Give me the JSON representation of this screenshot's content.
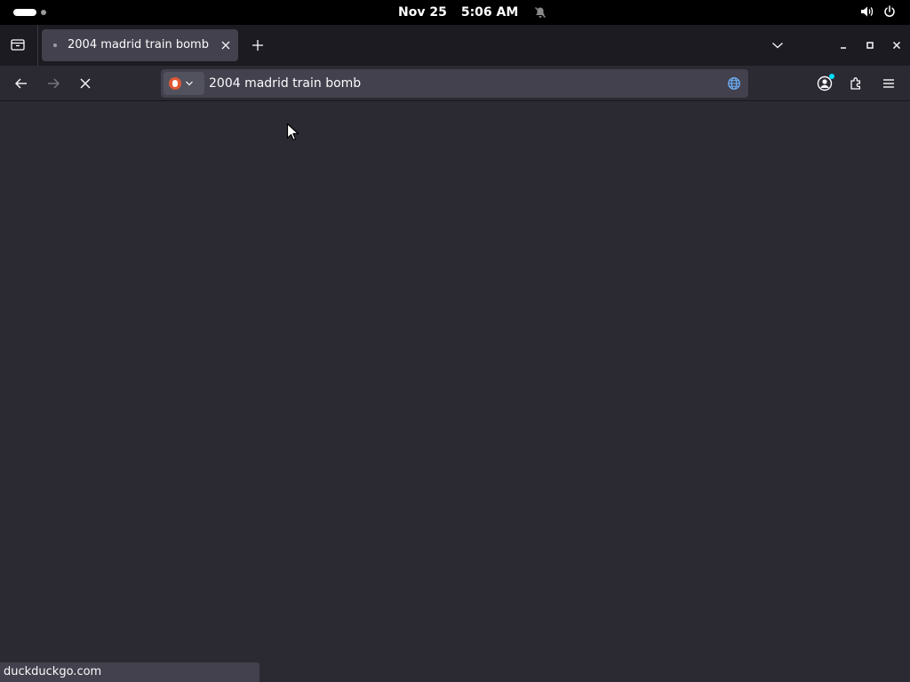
{
  "system_bar": {
    "date": "Nov 25",
    "time": "5:06 AM",
    "icons": [
      "activities-indicator",
      "notifications-off-icon",
      "volume-icon",
      "power-icon"
    ]
  },
  "browser": {
    "tabs": [
      {
        "title": "2004 madrid train bomb",
        "active": true
      }
    ],
    "address_bar": {
      "value": "2004 madrid train bomb",
      "search_engine": "DuckDuckGo"
    },
    "page_loading": true,
    "status_text": "duckduckgo.com"
  },
  "colors": {
    "chrome_dark": "#1c1b22",
    "toolbar": "#2b2a33",
    "field": "#42414d",
    "text": "#fbfbfe",
    "accent_blue": "#6fb4ff",
    "duckduckgo_orange": "#de5833"
  }
}
